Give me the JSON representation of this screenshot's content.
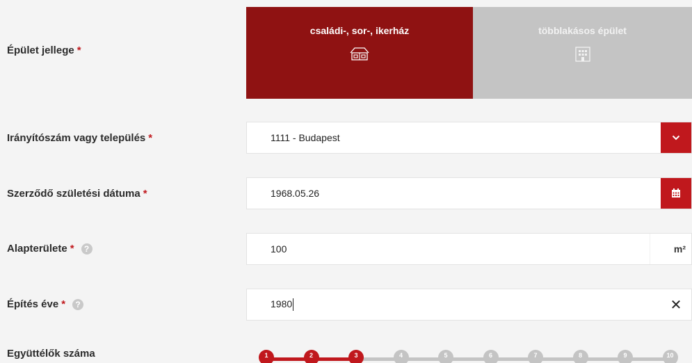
{
  "building_type": {
    "label": "Épület jellege",
    "required_mark": "*",
    "options": [
      {
        "label": "családi-, sor-, ikerház",
        "icon": "house-icon",
        "selected": true
      },
      {
        "label": "többlakásos épület",
        "icon": "apartment-building-icon",
        "selected": false
      }
    ]
  },
  "postal_code": {
    "label": "Irányítószám vagy település",
    "required_mark": "*",
    "value": "1111 - Budapest",
    "icon": "chevron-down-icon"
  },
  "birth_date": {
    "label": "Szerződő születési dátuma",
    "required_mark": "*",
    "value": "1968.05.26",
    "icon": "calendar-icon"
  },
  "floor_area": {
    "label": "Alapterülete",
    "required_mark": "*",
    "help": "?",
    "value": "100",
    "unit": "m²"
  },
  "build_year": {
    "label": "Építés éve",
    "required_mark": "*",
    "help": "?",
    "value": "1980",
    "clear_icon": "✕"
  },
  "occupants": {
    "label": "Együttélők száma",
    "steps": [
      "1",
      "2",
      "3",
      "4",
      "5",
      "6",
      "7",
      "8",
      "9",
      "10"
    ],
    "selected": 3
  },
  "colors": {
    "accent": "#c0181d",
    "active_tile": "#8f1212",
    "inactive": "#c4c4c4"
  }
}
